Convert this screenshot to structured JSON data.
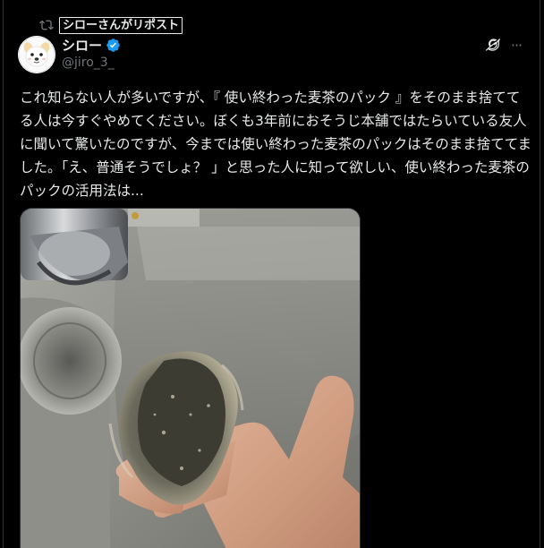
{
  "repost": {
    "icon": "repost-icon",
    "label": "シローさんがリポスト"
  },
  "author": {
    "avatar_icon": "dog-avatar",
    "display_name": "シロー",
    "verified_icon": "verified-badge-icon",
    "handle": "@jiro_3_"
  },
  "actions": {
    "grok_icon": "grok-icon",
    "more_label": "···"
  },
  "post": {
    "text": "これ知らない人が多いですが、『 使い終わった麦茶のパック 』をそのまま捨ててる人は今すぐやめてください。ぼくも3年前におそうじ本舗ではたらいている友人に聞いて驚いたのですが、今までは使い終わった麦茶のパックはそのまま捨ててました。「え、普通そうでしょ？ 」と思った人に知って欲しい、使い終わった麦茶のパックの活用法は..."
  },
  "media": {
    "description_icon": "photo-used-tea-bag"
  },
  "colors": {
    "background": "#000000",
    "text": "#e7e9ea",
    "muted": "#71767b",
    "verified": "#1d9bf0",
    "border": "#2f3336"
  }
}
